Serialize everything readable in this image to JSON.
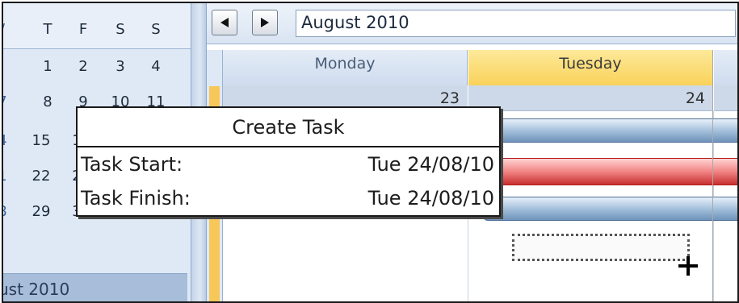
{
  "mini_calendar": {
    "weekday_headers": [
      "T",
      "F",
      "S",
      "S"
    ],
    "weeks": [
      {
        "partial": "",
        "days": [
          "1",
          "2",
          "3",
          "4"
        ]
      },
      {
        "partial": "7",
        "days": [
          "8",
          "9",
          "10",
          "11"
        ]
      },
      {
        "partial": "4",
        "days": [
          "15",
          "1"
        ]
      },
      {
        "partial": "1",
        "days": [
          "22",
          "2"
        ]
      },
      {
        "partial": "8",
        "days": [
          "29",
          "3"
        ]
      }
    ],
    "month_label": "ust 2010"
  },
  "toolbar": {
    "prev_icon": "triangle-left-icon",
    "next_icon": "triangle-right-icon",
    "month_title": "August 2010"
  },
  "scheduler": {
    "columns": [
      {
        "day": "Monday",
        "date": "23"
      },
      {
        "day": "Tuesday",
        "date": "24",
        "selected": true
      }
    ],
    "colors": {
      "selected_header": "#f9d25a",
      "task_blue": "#9fbcd9",
      "task_red": "#f18484"
    }
  },
  "tooltip": {
    "title": "Create Task",
    "start_label": "Task Start:",
    "start_value": "Tue 24/08/10",
    "finish_label": "Task Finish:",
    "finish_value": "Tue 24/08/10"
  }
}
